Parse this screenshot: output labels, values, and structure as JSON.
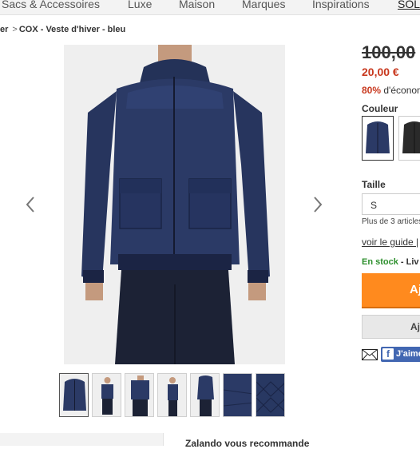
{
  "top_nav": {
    "items": [
      "Sacs & Accessoires",
      "Luxe",
      "Maison",
      "Marques",
      "Inspirations",
      "SOLDES"
    ]
  },
  "breadcrumb": {
    "parent": "er",
    "separator": ">",
    "current": "COX - Veste d'hiver - bleu"
  },
  "product": {
    "price_old": "100,00",
    "price_new": "20,00 €",
    "discount_pct": "80%",
    "discount_text": "d'économie",
    "color_label": "Couleur",
    "size_label": "Taille",
    "size_value": "S",
    "stock_note": "Plus de 3 articles",
    "guide_text": "voir le guide |",
    "in_stock": "En stock",
    "delivery_text": "- Liv",
    "add_to_cart": "Aj",
    "wishlist": "Aj",
    "fb_like": "J'aime",
    "fb_f": "f",
    "colors": {
      "price_red": "#c8381e",
      "cart_orange": "#ff8a1e",
      "stock_green": "#2d8f2d",
      "jacket_navy": "#2b3a66",
      "fb_blue": "#4267b2"
    }
  },
  "recommendations": {
    "title": "Zalando vous recommande"
  }
}
